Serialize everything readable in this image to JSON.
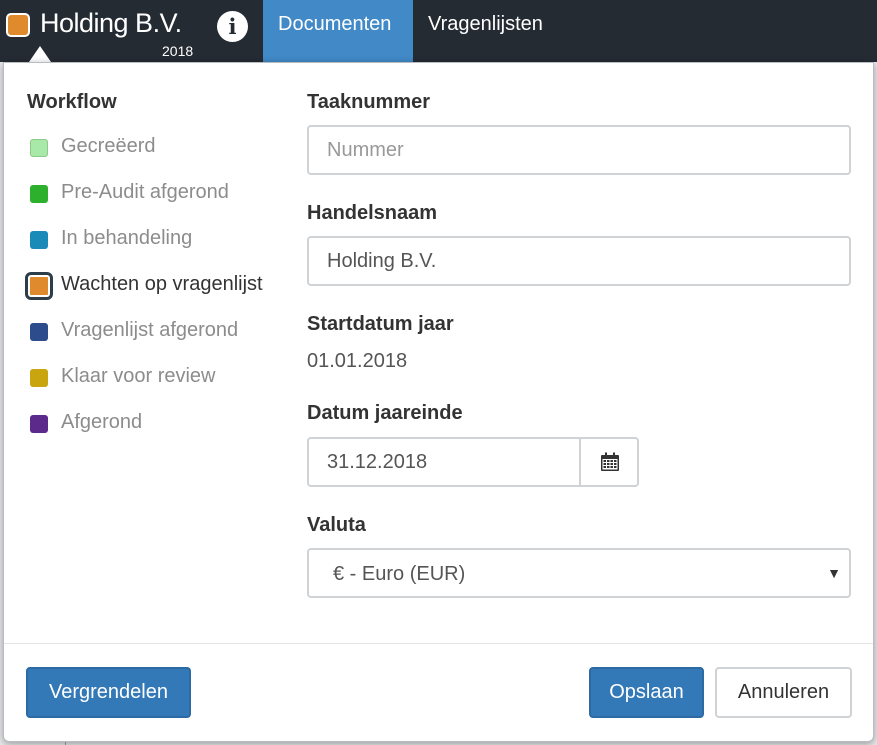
{
  "header": {
    "company_name": "Holding B.V.",
    "year": "2018",
    "status_color": "#e08a2e",
    "info_icon": "info-icon",
    "info_glyph": "i",
    "tabs": [
      {
        "label": "Documenten",
        "active": true
      },
      {
        "label": "Vragenlijsten",
        "active": false
      }
    ]
  },
  "workflow": {
    "heading": "Workflow",
    "items": [
      {
        "label": "Gecreëerd",
        "color": "#a8e8a8",
        "current": false
      },
      {
        "label": "Pre-Audit afgerond",
        "color": "#2db12d",
        "current": false
      },
      {
        "label": "In behandeling",
        "color": "#1a8ab8",
        "current": false
      },
      {
        "label": "Wachten op vragenlijst",
        "color": "#e08a2e",
        "current": true
      },
      {
        "label": "Vragenlijst afgerond",
        "color": "#2c4c8c",
        "current": false
      },
      {
        "label": "Klaar voor review",
        "color": "#c9a50f",
        "current": false
      },
      {
        "label": "Afgerond",
        "color": "#5c2a8a",
        "current": false
      }
    ]
  },
  "form": {
    "taaknummer": {
      "label": "Taaknummer",
      "value": "",
      "placeholder": "Nummer"
    },
    "handelsnaam": {
      "label": "Handelsnaam",
      "value": "Holding B.V."
    },
    "startdatum": {
      "label": "Startdatum jaar",
      "value": "01.01.2018"
    },
    "jaareinde": {
      "label": "Datum jaareinde",
      "value": "31.12.2018",
      "button_icon": "calendar-icon"
    },
    "valuta": {
      "label": "Valuta",
      "selected": "€ - Euro (EUR)",
      "arrow": "▼"
    }
  },
  "footer": {
    "lock_label": "Vergrendelen",
    "save_label": "Opslaan",
    "cancel_label": "Annuleren"
  },
  "colors": {
    "primary": "#3379b8",
    "navbar": "#252b33",
    "active_tab": "#4189c7"
  }
}
